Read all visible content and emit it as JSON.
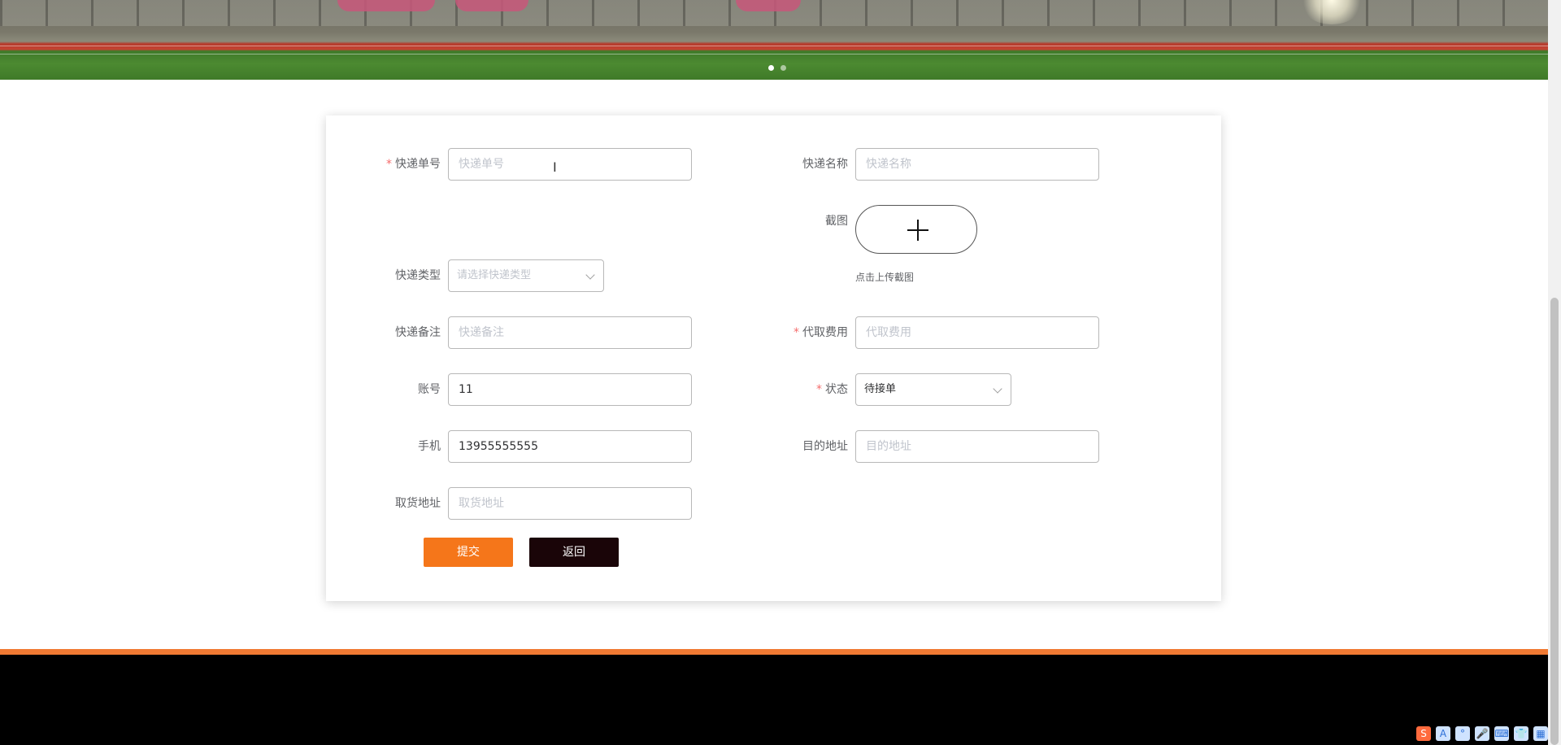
{
  "banner": {
    "carousel_slides": 2,
    "active_slide": 0
  },
  "form": {
    "tracking_number": {
      "label": "快递单号",
      "required": true,
      "value": "",
      "placeholder": "快递单号"
    },
    "express_name": {
      "label": "快递名称",
      "required": false,
      "value": "",
      "placeholder": "快递名称"
    },
    "screenshot": {
      "label": "截图",
      "hint": "点击上传截图"
    },
    "express_type": {
      "label": "快递类型",
      "placeholder": "请选择快递类型"
    },
    "remark": {
      "label": "快递备注",
      "value": "",
      "placeholder": "快递备注"
    },
    "fee": {
      "label": "代取费用",
      "required": true,
      "value": "",
      "placeholder": "代取费用"
    },
    "account": {
      "label": "账号",
      "value": "11"
    },
    "status": {
      "label": "状态",
      "required": true,
      "value": "待接单"
    },
    "phone": {
      "label": "手机",
      "value": "13955555555"
    },
    "destination": {
      "label": "目的地址",
      "value": "",
      "placeholder": "目的地址"
    },
    "pickup_address": {
      "label": "取货地址",
      "value": "",
      "placeholder": "取货地址"
    }
  },
  "buttons": {
    "submit": "提交",
    "back": "返回"
  },
  "tray": {
    "icons": [
      "app-logo-icon",
      "font-icon",
      "punctuation-icon",
      "microphone-icon",
      "keyboard-icon",
      "shirt-icon",
      "grid-icon"
    ],
    "labels": [
      "S",
      "A",
      "°",
      "🎤",
      "⌨",
      "👕",
      "▦"
    ]
  },
  "colors": {
    "accent": "#f5761a",
    "footer": "#000000",
    "footer_line": "#f07a33",
    "required": "#f56c6c"
  }
}
